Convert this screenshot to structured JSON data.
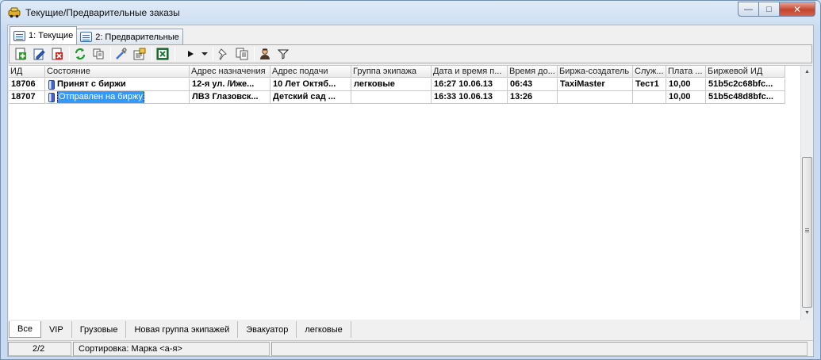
{
  "window": {
    "title": "Текущие/Предварительные заказы",
    "controls": {
      "minimize": "—",
      "maximize": "□",
      "close": "✕"
    }
  },
  "tabs": [
    {
      "label": "1: Текущие",
      "active": true
    },
    {
      "label": "2: Предварительные",
      "active": false
    }
  ],
  "toolbar": {
    "buttons": [
      "add-order-icon",
      "edit-order-icon",
      "delete-order-icon",
      "refresh-icon",
      "copy-icon",
      "tools-icon",
      "properties-icon",
      "excel-export-icon",
      "play-icon",
      "dropdown-arrow-icon",
      "pin-icon",
      "copy-documents-icon",
      "driver-icon",
      "filter-icon"
    ]
  },
  "grid": {
    "columns": [
      "ИД",
      "Состояние",
      "Адрес назначения",
      "Адрес подачи",
      "Группа экипажа",
      "Дата и время п...",
      "Время до...",
      "Биржа-создатель",
      "Служ...",
      "Плата ...",
      "Биржевой ИД"
    ],
    "rows": [
      {
        "id": "18706",
        "state": "Принят с биржи",
        "dest": "12-я ул. /Иже...",
        "pickup": "10 Лет Октяб...",
        "group": "легковые",
        "datetime": "16:27 10.06.13",
        "time_to": "06:43",
        "creator": "TaxiMaster",
        "service": "Тест1",
        "fee": "10,00",
        "exchange_id": "51b5c2c68bfc..."
      },
      {
        "id": "18707",
        "state": "Отправлен на биржу",
        "dest": "ЛВЗ Глазовск...",
        "pickup": "Детский сад ...",
        "group": "",
        "datetime": "16:33 10.06.13",
        "time_to": "13:26",
        "creator": "",
        "service": "",
        "fee": "10,00",
        "exchange_id": "51b5c48d8bfc..."
      }
    ]
  },
  "bottom_tabs": [
    {
      "label": "Все",
      "active": true
    },
    {
      "label": "VIP",
      "active": false
    },
    {
      "label": "Грузовые",
      "active": false
    },
    {
      "label": "Новая группа экипажей",
      "active": false
    },
    {
      "label": "Эвакуатор",
      "active": false
    },
    {
      "label": "легковые",
      "active": false
    }
  ],
  "status": {
    "count": "2/2",
    "sort": "Сортировка: Марка <а-я>"
  }
}
